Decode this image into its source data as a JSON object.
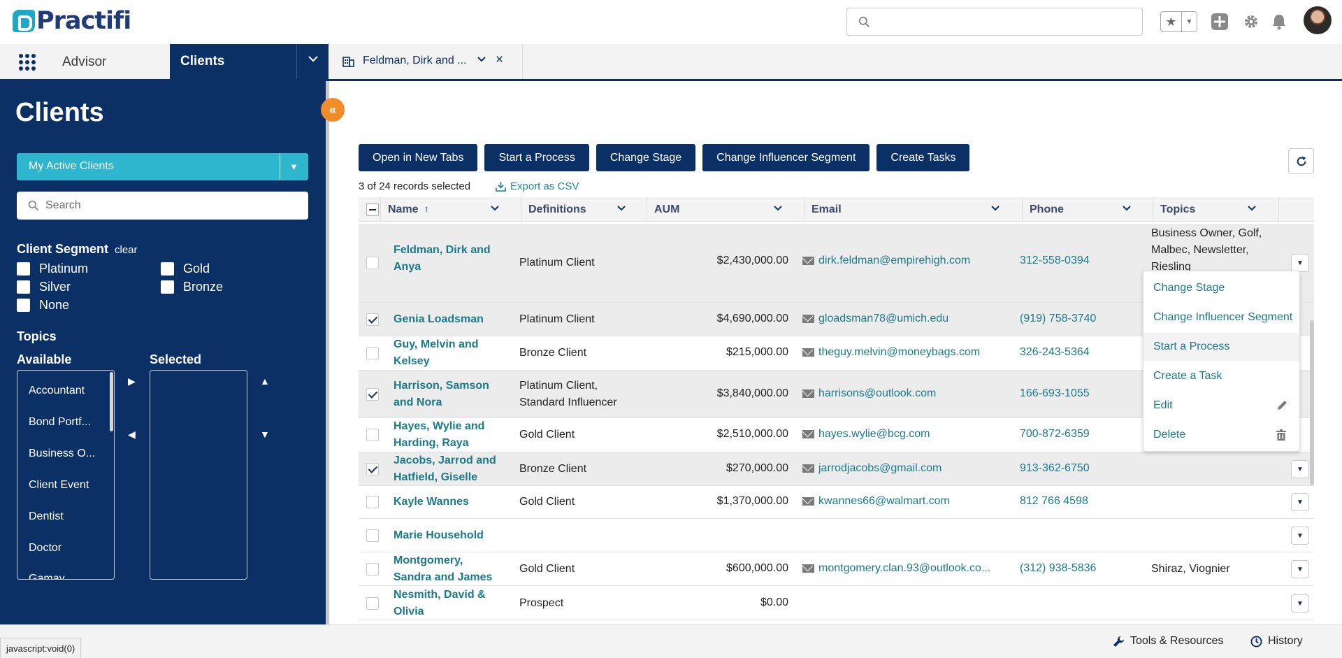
{
  "header": {
    "logo_text": "Practifi",
    "search_placeholder": ""
  },
  "nav": {
    "app_name": "Advisor",
    "active_item": "Clients",
    "record_tab": "Feldman, Dirk and ..."
  },
  "left_panel": {
    "title": "Clients",
    "list_view": "My Active Clients",
    "search_placeholder": "Search",
    "segment_title": "Client Segment",
    "segment_clear": "clear",
    "segments": [
      "Platinum",
      "Gold",
      "Silver",
      "Bronze",
      "None"
    ],
    "topics_title": "Topics",
    "available_title": "Available",
    "selected_title": "Selected",
    "available_topics": [
      "Accountant",
      "Bond Portf...",
      "Business O...",
      "Client Event",
      "Dentist",
      "Doctor",
      "Gamay"
    ]
  },
  "actions": {
    "buttons": [
      "Open in New Tabs",
      "Start a Process",
      "Change Stage",
      "Change Influencer Segment",
      "Create Tasks"
    ],
    "record_count": "3 of 24 records selected",
    "export_label": "Export as CSV"
  },
  "table": {
    "columns": [
      "Name",
      "Definitions",
      "AUM",
      "Email",
      "Phone",
      "Topics"
    ],
    "rows": [
      {
        "name1": "Feldman, Dirk and",
        "name2": "Anya",
        "def1": "Platinum Client",
        "def2": "",
        "aum": "$2,430,000.00",
        "email": "dirk.feldman@empirehigh.com",
        "phone": "312-558-0394",
        "topics": "Business Owner, Golf, Malbec, Newsletter, Riesling",
        "checked": false
      },
      {
        "name1": "Genia Loadsman",
        "name2": "",
        "def1": "Platinum Client",
        "def2": "",
        "aum": "$4,690,000.00",
        "email": "gloadsman78@umich.edu",
        "phone": "(919) 758-3740",
        "topics": "",
        "checked": true
      },
      {
        "name1": "Guy, Melvin and",
        "name2": "Kelsey",
        "def1": "Bronze Client",
        "def2": "",
        "aum": "$215,000.00",
        "email": "theguy.melvin@moneybags.com",
        "phone": "326-243-5364",
        "topics": "",
        "checked": false
      },
      {
        "name1": "Harrison, Samson",
        "name2": "and Nora",
        "def1": "Platinum Client,",
        "def2": "Standard Influencer",
        "aum": "$3,840,000.00",
        "email": "harrisons@outlook.com",
        "phone": "166-693-1055",
        "topics": "",
        "checked": true
      },
      {
        "name1": "Hayes, Wylie and",
        "name2": "Harding, Raya",
        "def1": "Gold Client",
        "def2": "",
        "aum": "$2,510,000.00",
        "email": "hayes.wylie@bcg.com",
        "phone": "700-872-6359",
        "topics": "",
        "checked": false
      },
      {
        "name1": "Jacobs, Jarrod and",
        "name2": "Hatfield, Giselle",
        "def1": "Bronze Client",
        "def2": "",
        "aum": "$270,000.00",
        "email": "jarrodjacobs@gmail.com",
        "phone": "913-362-6750",
        "topics": "",
        "checked": true
      },
      {
        "name1": "Kayle Wannes",
        "name2": "",
        "def1": "Gold Client",
        "def2": "",
        "aum": "$1,370,000.00",
        "email": "kwannes66@walmart.com",
        "phone": "812 766 4598",
        "topics": "",
        "checked": false
      },
      {
        "name1": "Marie Household",
        "name2": "",
        "def1": "",
        "def2": "",
        "aum": "",
        "email": "",
        "phone": "",
        "topics": "",
        "checked": false
      },
      {
        "name1": "Montgomery,",
        "name2": "Sandra and James",
        "def1": "Gold Client",
        "def2": "",
        "aum": "$600,000.00",
        "email": "montgomery.clan.93@outlook.co...",
        "phone": "(312) 938-5836",
        "topics": "Shiraz, Viognier",
        "checked": false
      },
      {
        "name1": "Nesmith, David &",
        "name2": "Olivia",
        "def1": "Prospect",
        "def2": "",
        "aum": "$0.00",
        "email": "",
        "phone": "",
        "topics": "",
        "checked": false
      }
    ]
  },
  "row_menu": {
    "items": [
      "Change Stage",
      "Change Influencer Segment",
      "Start a Process",
      "Create a Task",
      "Edit",
      "Delete"
    ]
  },
  "footer": {
    "status_url": "javascript:void(0)",
    "tools_label": "Tools & Resources",
    "history_label": "History"
  },
  "colors": {
    "navy": "#0b3065",
    "teal": "#2eb6cf",
    "link": "#1a7a8a",
    "orange": "#f28c28"
  }
}
